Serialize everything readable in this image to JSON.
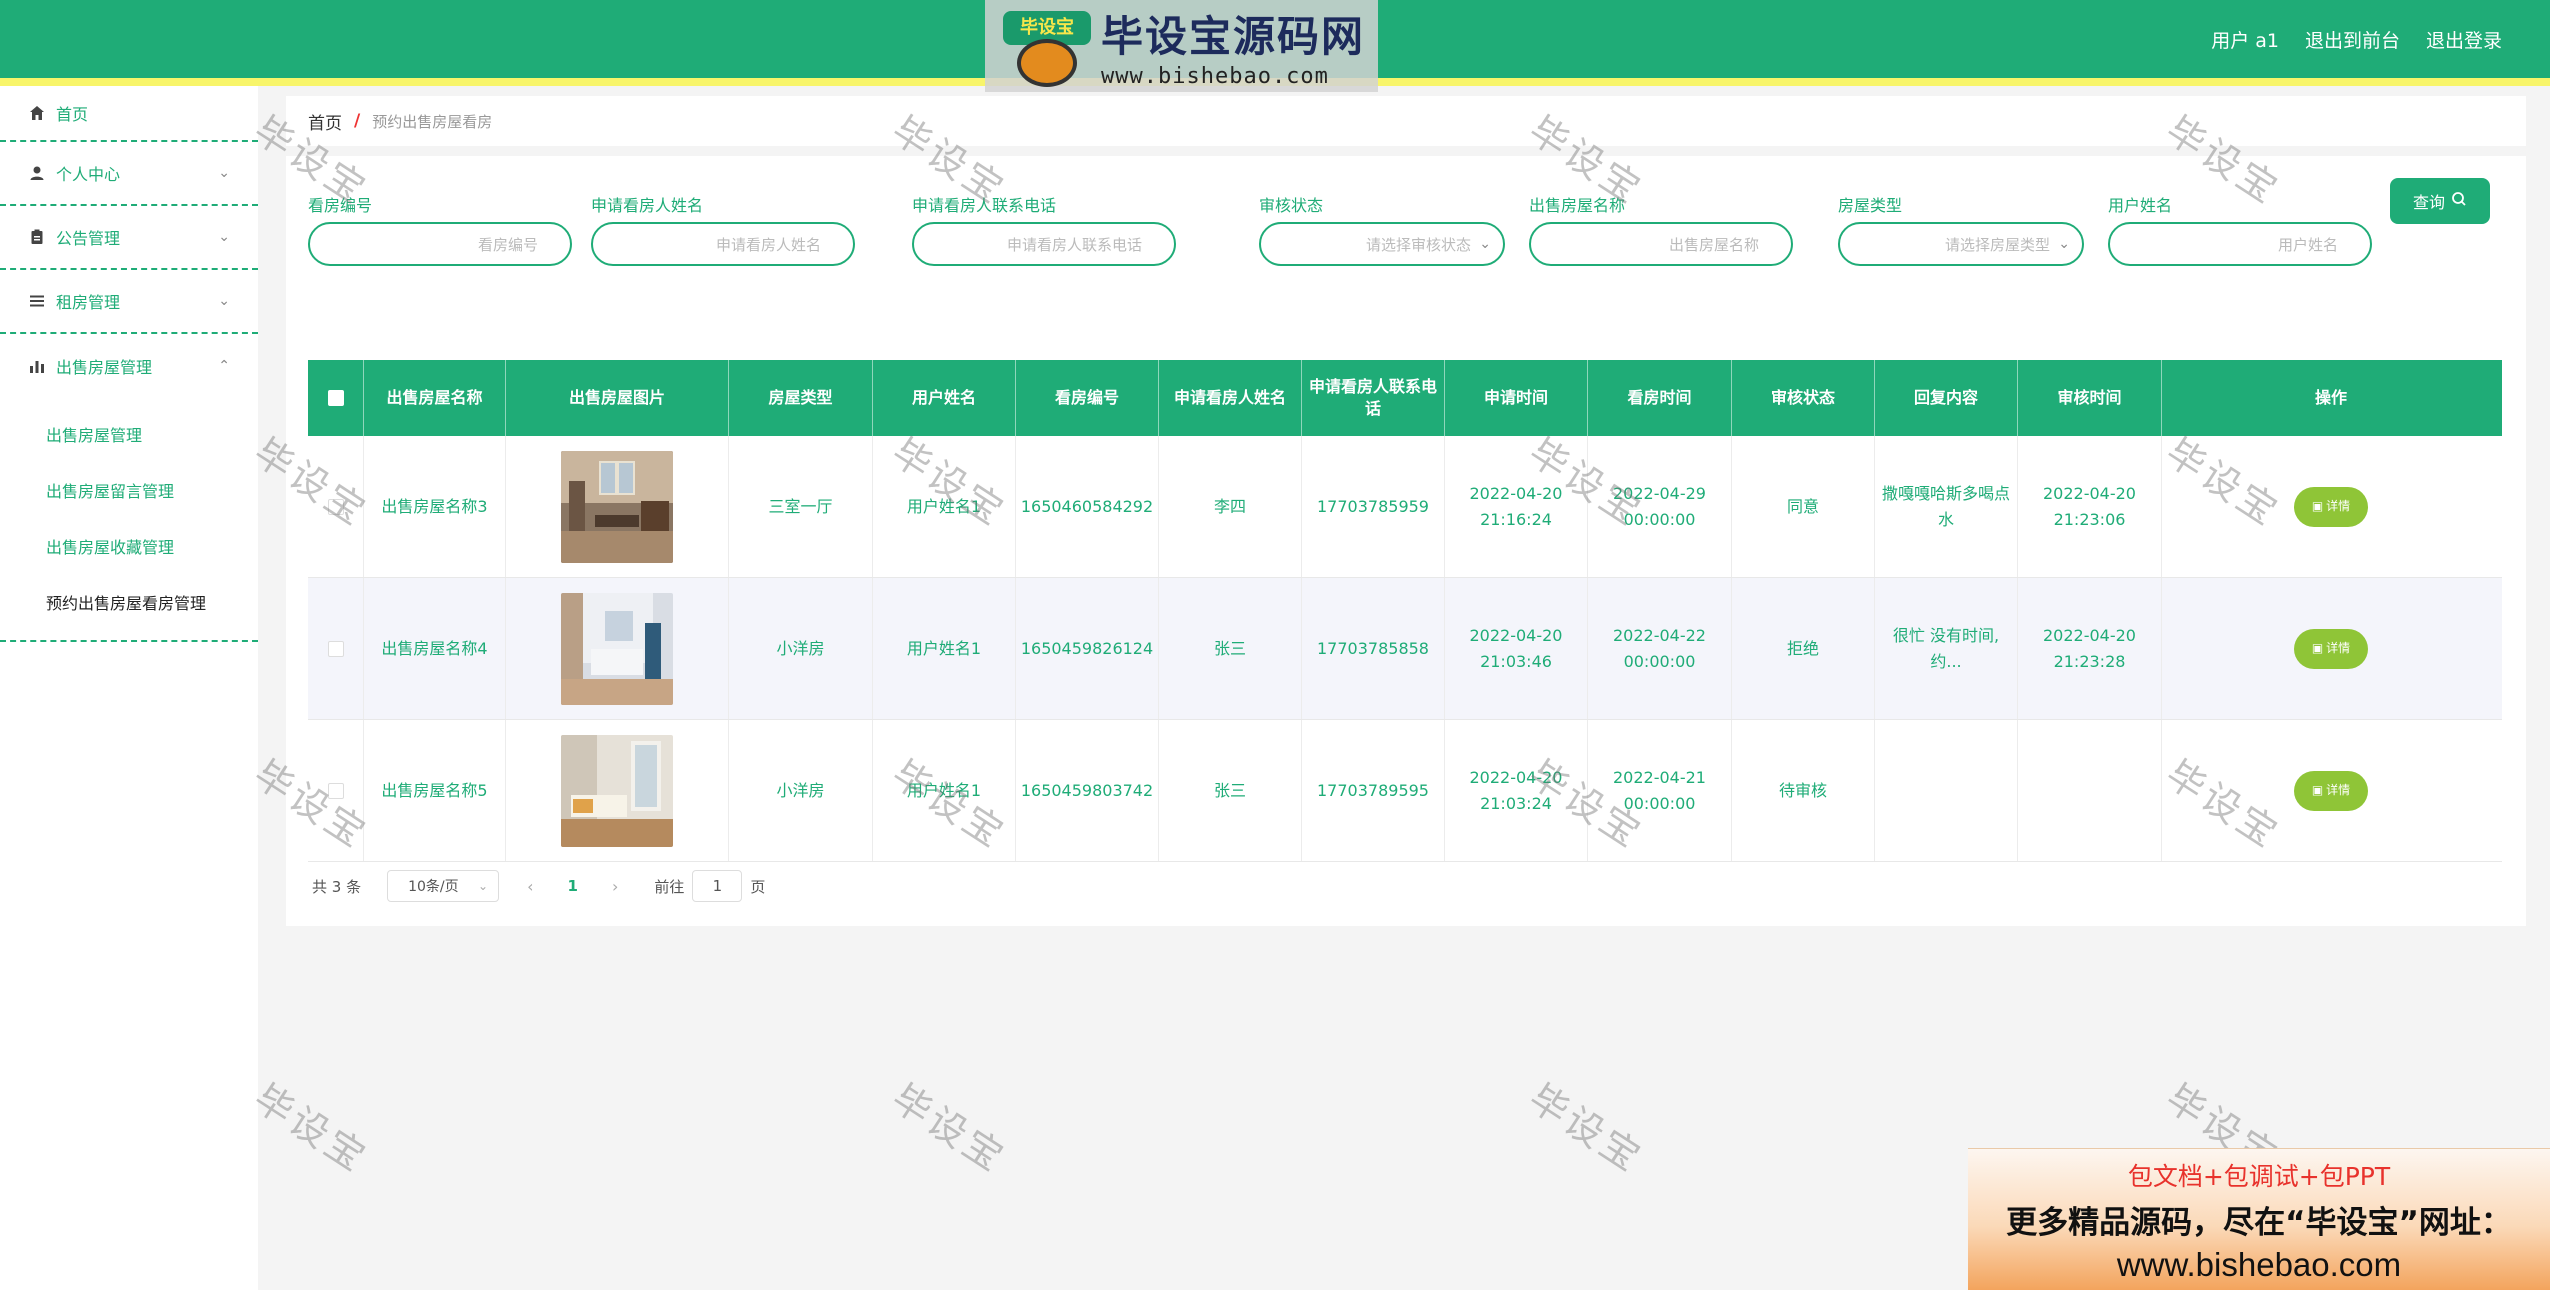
{
  "header": {
    "logo_text": "毕设宝源码网",
    "logo_badge": "毕设宝",
    "logo_url": "www.bishebao.com",
    "user_label": "用户 a1",
    "to_front_label": "退出到前台",
    "logout_label": "退出登录"
  },
  "sidebar": {
    "items": [
      {
        "label": "首页",
        "icon": "home-icon"
      },
      {
        "label": "个人中心",
        "icon": "user-icon"
      },
      {
        "label": "公告管理",
        "icon": "clipboard-icon"
      },
      {
        "label": "租房管理",
        "icon": "list-icon"
      },
      {
        "label": "出售房屋管理",
        "icon": "bar-chart-icon"
      }
    ],
    "subitems": [
      {
        "label": "出售房屋管理"
      },
      {
        "label": "出售房屋留言管理"
      },
      {
        "label": "出售房屋收藏管理"
      },
      {
        "label": "预约出售房屋看房管理"
      }
    ]
  },
  "breadcrumb": {
    "home": "首页",
    "separator": "/",
    "current": "预约出售房屋看房"
  },
  "filters": [
    {
      "label": "看房编号",
      "placeholder": "看房编号"
    },
    {
      "label": "申请看房人姓名",
      "placeholder": "申请看房人姓名"
    },
    {
      "label": "申请看房人联系电话",
      "placeholder": "申请看房人联系电话"
    },
    {
      "label": "审核状态",
      "placeholder": "请选择审核状态"
    },
    {
      "label": "出售房屋名称",
      "placeholder": "出售房屋名称"
    },
    {
      "label": "房屋类型",
      "placeholder": "请选择房屋类型"
    },
    {
      "label": "用户姓名",
      "placeholder": "用户姓名"
    }
  ],
  "query_label": "查询",
  "table": {
    "columns": [
      "出售房屋名称",
      "出售房屋图片",
      "房屋类型",
      "用户姓名",
      "看房编号",
      "申请看房人姓名",
      "申请看房人联系电话",
      "申请时间",
      "看房时间",
      "审核状态",
      "回复内容",
      "审核时间",
      "操作"
    ],
    "rows": [
      {
        "name": "出售房屋名称3",
        "type": "三室一厅",
        "user": "用户姓名1",
        "code": "1650460584292",
        "applicant": "李四",
        "phone": "17703785959",
        "apply_time": "2022-04-20 21:16:24",
        "view_time": "2022-04-29 00:00:00",
        "status": "同意",
        "reply": "撒嘎嘎哈斯多喝点水",
        "review_time": "2022-04-20 21:23:06"
      },
      {
        "name": "出售房屋名称4",
        "type": "小洋房",
        "user": "用户姓名1",
        "code": "1650459826124",
        "applicant": "张三",
        "phone": "17703785858",
        "apply_time": "2022-04-20 21:03:46",
        "view_time": "2022-04-22 00:00:00",
        "status": "拒绝",
        "reply": "很忙 没有时间,约...",
        "review_time": "2022-04-20 21:23:28"
      },
      {
        "name": "出售房屋名称5",
        "type": "小洋房",
        "user": "用户姓名1",
        "code": "1650459803742",
        "applicant": "张三",
        "phone": "17703789595",
        "apply_time": "2022-04-20 21:03:24",
        "view_time": "2022-04-21 00:00:00",
        "status": "待审核",
        "reply": "",
        "review_time": ""
      }
    ],
    "detail_label": "详情"
  },
  "pagination": {
    "total": "共 3 条",
    "page_size": "10条/页",
    "current_page": "1",
    "goto_label": "前往",
    "goto_value": "1",
    "page_suffix": "页"
  },
  "watermark": "毕设宝",
  "ad": {
    "line1": "包文档+包调试+包PPT",
    "line2": "更多精品源码，尽在“毕设宝”网址：",
    "line3": "www.bishebao.com"
  }
}
